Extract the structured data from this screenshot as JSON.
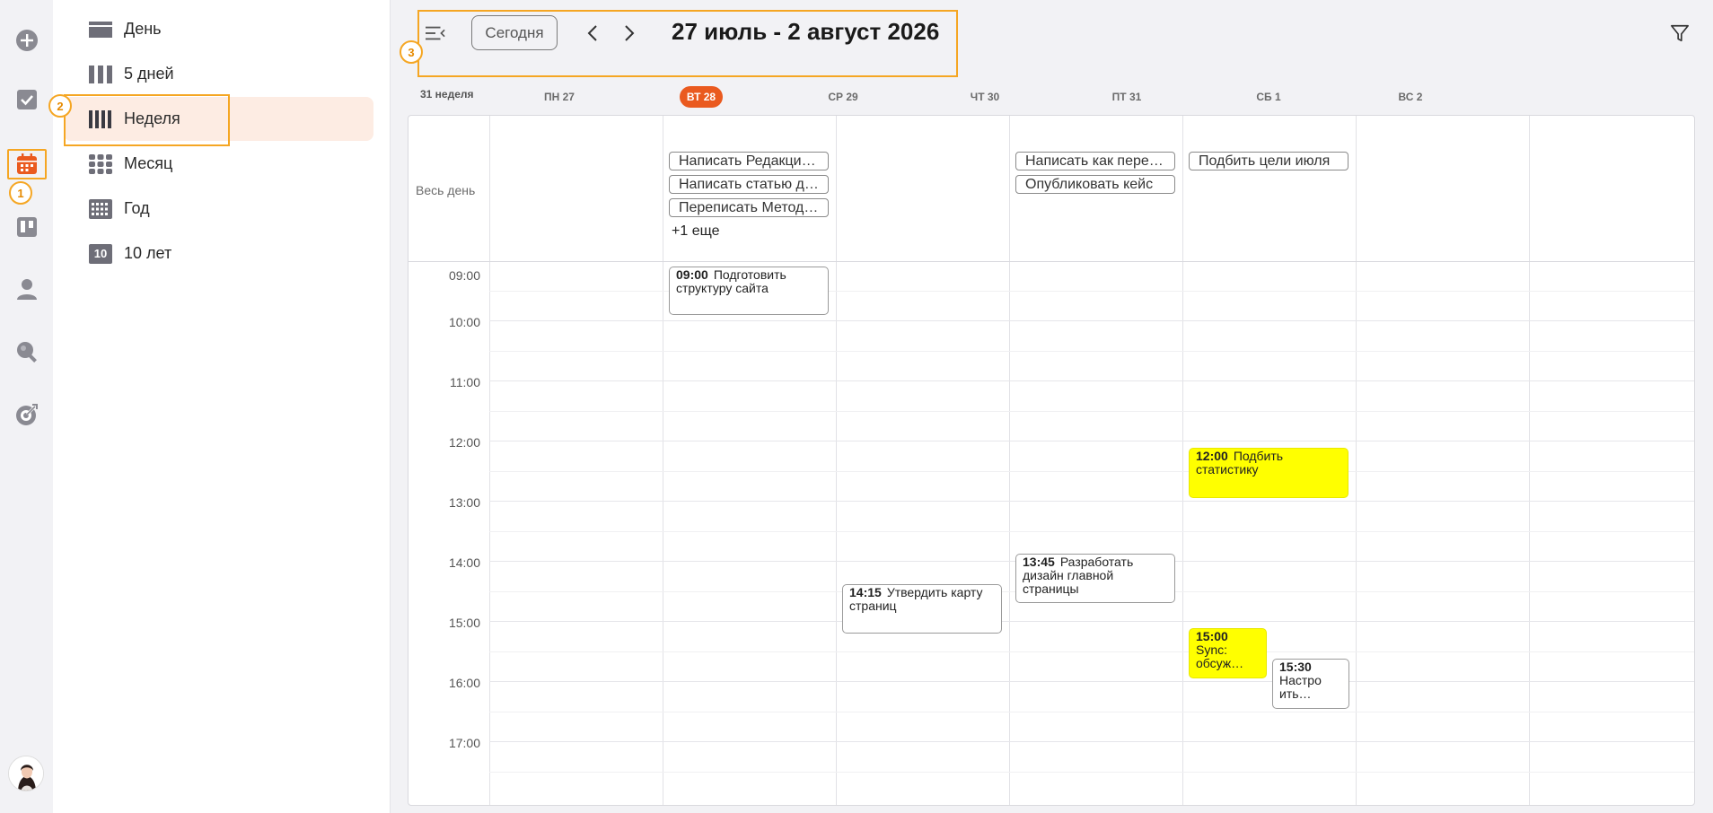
{
  "views": {
    "items": [
      {
        "label": "День",
        "icon": "day-view-icon"
      },
      {
        "label": "5 дней",
        "icon": "five-days-view-icon"
      },
      {
        "label": "Неделя",
        "icon": "week-view-icon"
      },
      {
        "label": "Месяц",
        "icon": "month-view-icon"
      },
      {
        "label": "Год",
        "icon": "year-view-icon"
      },
      {
        "label": "10 лет",
        "icon_text": "10"
      }
    ],
    "active": "Неделя"
  },
  "markers": {
    "rail": "1",
    "views": "2",
    "header": "3"
  },
  "header": {
    "today_label": "Сегодня",
    "range_title": "27 июль - 2 август 2026"
  },
  "week_label": "31 неделя",
  "days": [
    {
      "label": "ПН 27",
      "today": false
    },
    {
      "label": "ВТ 28",
      "today": true
    },
    {
      "label": "СР 29",
      "today": false
    },
    {
      "label": "ЧТ 30",
      "today": false
    },
    {
      "label": "ПТ 31",
      "today": false
    },
    {
      "label": "СБ 1",
      "today": false
    },
    {
      "label": "ВС 2",
      "today": false
    }
  ],
  "allday_label": "Весь день",
  "allday_events": {
    "tue": [
      "Написать Редакционную",
      "Написать статью для",
      "Переписать Методичку"
    ],
    "tue_more": "+1 еще",
    "thu": [
      "Написать как перенести",
      "Опубликовать кейс"
    ],
    "fri": [
      "Подбить цели июля"
    ]
  },
  "times": [
    "09:00",
    "10:00",
    "11:00",
    "12:00",
    "13:00",
    "14:00",
    "15:00",
    "16:00",
    "17:00"
  ],
  "events": {
    "e1": {
      "time": "09:00",
      "title": "Подготовить структуру сайта"
    },
    "e2": {
      "time": "12:00",
      "title": "Подбить статистику"
    },
    "e3": {
      "time": "13:45",
      "title": "Разработать дизайн главной страницы"
    },
    "e4": {
      "time": "14:15",
      "title": "Утвердить карту страниц"
    },
    "e5": {
      "time": "15:00",
      "title": "Sync: обсуж…"
    },
    "e6": {
      "time": "15:30",
      "title": "Настро ить…"
    }
  },
  "colors": {
    "accent": "#ea5a1f",
    "highlight": "#f5a623",
    "event_yellow": "#ffff00"
  }
}
